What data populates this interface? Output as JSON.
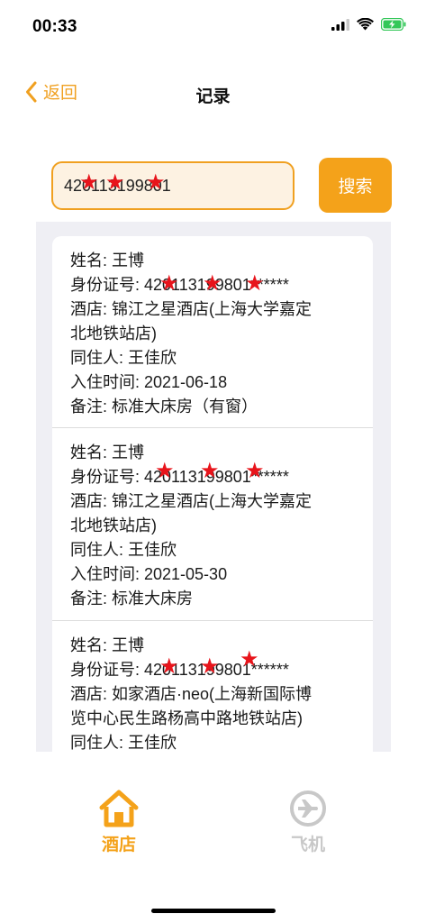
{
  "status_bar": {
    "time": "00:33"
  },
  "nav": {
    "back_label": "返回",
    "title": "记录"
  },
  "search": {
    "value": "420113199801"
  },
  "actions": {
    "search_label": "搜索"
  },
  "records": [
    {
      "name_label": "姓名: 王博",
      "id_label": "身份证号: 420113199801******",
      "hotel_label": "酒店: 锦江之星酒店(上海大学嘉定",
      "hotel_label_cont": "北地铁站店)",
      "cohabitant_label": "同住人: 王佳欣",
      "checkin_label": "入住时间: 2021-06-18",
      "remark_label": "备注: 标准大床房（有窗）"
    },
    {
      "name_label": "姓名: 王博",
      "id_label": "身份证号: 420113199801******",
      "hotel_label": "酒店: 锦江之星酒店(上海大学嘉定",
      "hotel_label_cont": "北地铁站店)",
      "cohabitant_label": "同住人: 王佳欣",
      "checkin_label": "入住时间: 2021-05-30",
      "remark_label": "备注: 标准大床房"
    },
    {
      "name_label": "姓名: 王博",
      "id_label": "身份证号: 420113199801******",
      "hotel_label": "酒店: 如家酒店·neo(上海新国际博",
      "hotel_label_cont": "览中心民生路杨高中路地铁站店)",
      "cohabitant_label": "同住人: 王佳欣"
    }
  ],
  "tabs": [
    {
      "label": "酒店",
      "icon": "home-icon",
      "active": true
    },
    {
      "label": "飞机",
      "icon": "airplane-icon",
      "active": false
    }
  ],
  "colors": {
    "accent": "#f4a21a",
    "inactive": "#c8c8c8",
    "star": "#e8141b"
  }
}
